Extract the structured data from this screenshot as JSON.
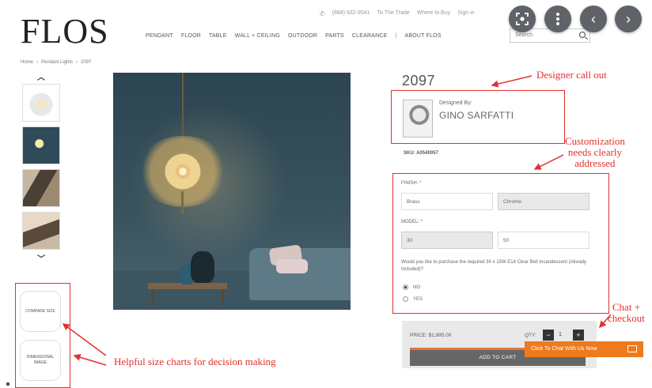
{
  "header": {
    "logo": "FLOS",
    "util_links": [
      "(888) 932-9541",
      "To The Trade",
      "Where to Buy",
      "Sign in"
    ],
    "nav_items": [
      "PENDANT",
      "FLOOR",
      "TABLE",
      "WALL + CEILING",
      "OUTDOOR",
      "PARTS",
      "CLEARANCE",
      "ABOUT FLOS"
    ],
    "search_placeholder": "Search"
  },
  "overlay_buttons": {
    "lens_icon": "lens-icon",
    "more_icon": "more-vertical-icon",
    "prev": "‹",
    "next": "›"
  },
  "breadcrumb": [
    "Home",
    "Pendant Lights",
    "2097"
  ],
  "thumbnails": {
    "size_items": [
      "COMPARE SIZE",
      "DIMENSIONAL IMAGE"
    ]
  },
  "product": {
    "title": "2097",
    "designed_by_label": "Designed By:",
    "designer_name": "GINO SARFATTI",
    "sku": "SKU: A0540057",
    "finish_label": "FINISH:",
    "finish_options": [
      "Brass",
      "Chrome"
    ],
    "model_label": "MODEL:",
    "model_options": [
      "30",
      "50"
    ],
    "question": "Would you like to purchase the required 30 x 15W E14 Clear Bell Incandescent (Already Included)?",
    "radio_options": [
      "NO",
      "YES"
    ],
    "price": "PRICE: $1,995.00",
    "qty_label": "QTY:",
    "qty_value": "1",
    "qty_minus": "−",
    "qty_plus": "+",
    "add_to_cart": "ADD TO CART",
    "chat_label": "Click To Chat With Us Now"
  },
  "annotations": {
    "designer": "Designer call out",
    "customization": "Customization\nneeds clearly\naddressed",
    "chat": "Chat +\ncheckout",
    "size_charts": "Helpful size charts for decision making"
  },
  "colors": {
    "annotation": "#e0312d",
    "chat_orange": "#ee7a1c",
    "overlay_button": "#5f6368"
  }
}
